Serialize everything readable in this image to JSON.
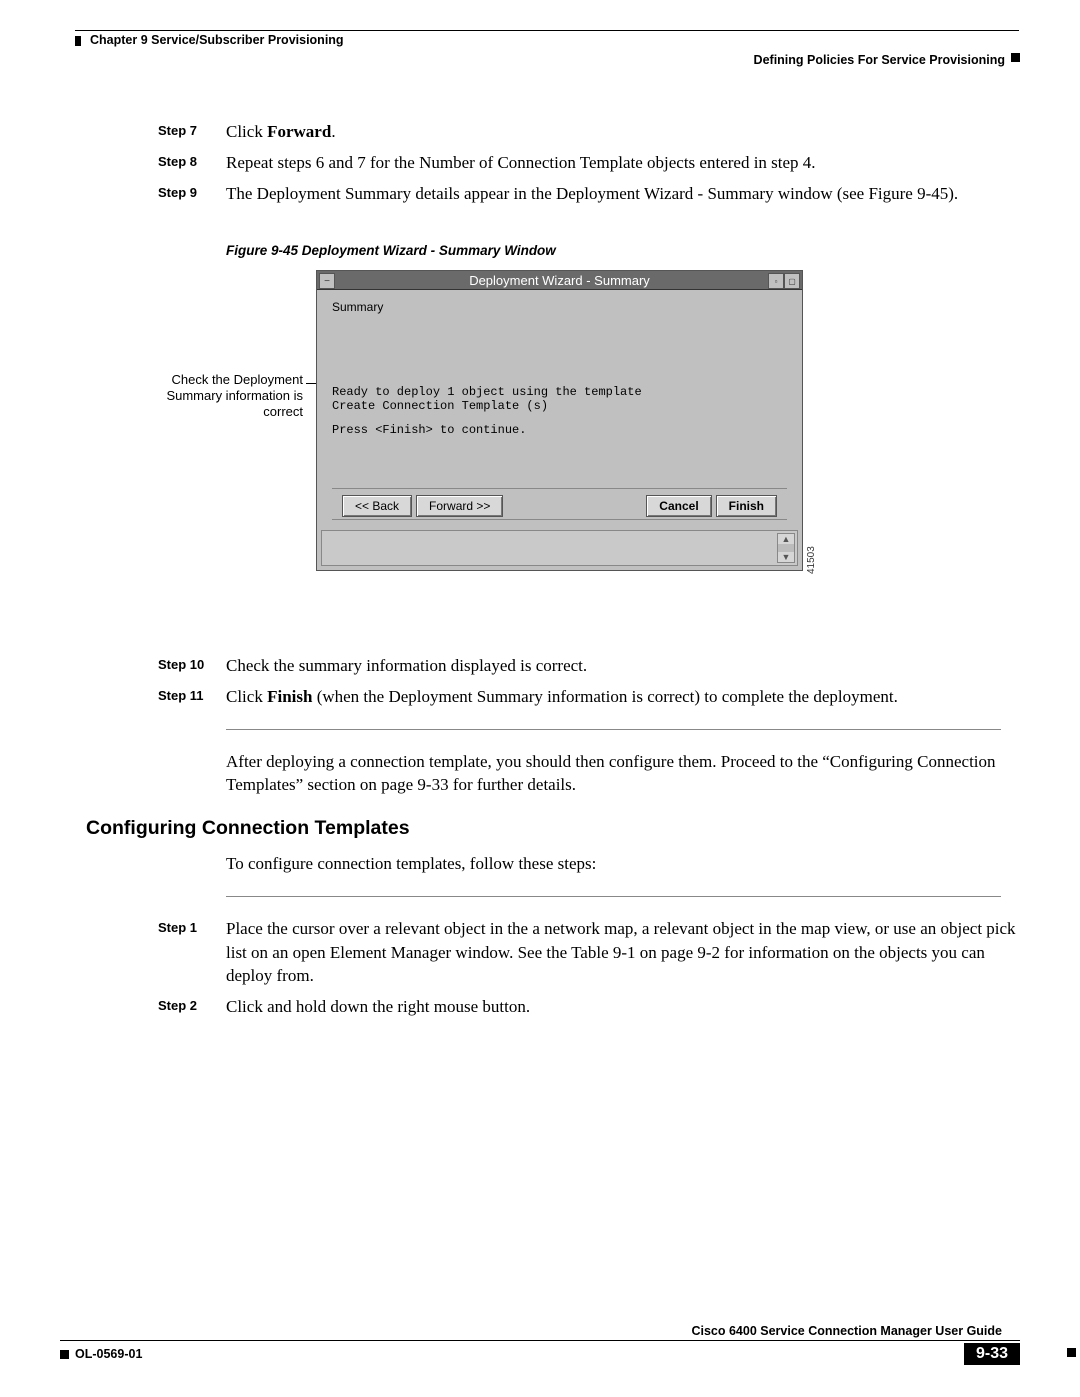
{
  "header": {
    "chapter": "Chapter 9    Service/Subscriber Provisioning",
    "section": "Defining Policies For Service Provisioning"
  },
  "steps_a": [
    {
      "label": "Step 7",
      "text_pre": "Click ",
      "bold": "Forward",
      "text_post": "."
    },
    {
      "label": "Step 8",
      "text": "Repeat steps 6 and 7 for the Number of Connection Template objects entered in step 4."
    },
    {
      "label": "Step 9",
      "text": "The Deployment Summary details appear in the Deployment Wizard - Summary window (see Figure 9-45)."
    }
  ],
  "figure": {
    "caption": "Figure 9-45  Deployment Wizard - Summary Window",
    "callout": "Check the Deployment Summary information is correct",
    "window_title": "Deployment Wizard - Summary",
    "summary_label": "Summary",
    "msg_line1": "Ready to deploy 1 object using the template",
    "msg_line2": "Create Connection Template (s)",
    "msg_line3": "Press <Finish> to continue.",
    "btn_back": "<< Back",
    "btn_forward": "Forward >>",
    "btn_cancel": "Cancel",
    "btn_finish": "Finish",
    "fig_num": "41503"
  },
  "steps_b": [
    {
      "label": "Step 10",
      "text": "Check the summary information displayed is correct."
    },
    {
      "label": "Step 11",
      "text_pre": "Click ",
      "bold": "Finish",
      "text_post": " (when the Deployment Summary information is correct) to complete the deployment."
    }
  ],
  "post_para": "After deploying a connection template, you should then configure them. Proceed to the “Configuring Connection Templates” section on page 9-33 for further details.",
  "section_heading": "Configuring Connection Templates",
  "section_intro": "To configure connection templates, follow these steps:",
  "steps_c": [
    {
      "label": "Step 1",
      "text": "Place the cursor over a relevant object in the a network map, a relevant object in the map view, or use an object pick list on an open Element Manager window. See the Table 9-1 on page 9-2 for information on the objects you can deploy from."
    },
    {
      "label": "Step 2",
      "text": "Click and hold down the right mouse button."
    }
  ],
  "footer": {
    "guide": "Cisco 6400 Service Connection Manager User Guide",
    "ol": "OL-0569-01",
    "page": "9-33"
  }
}
